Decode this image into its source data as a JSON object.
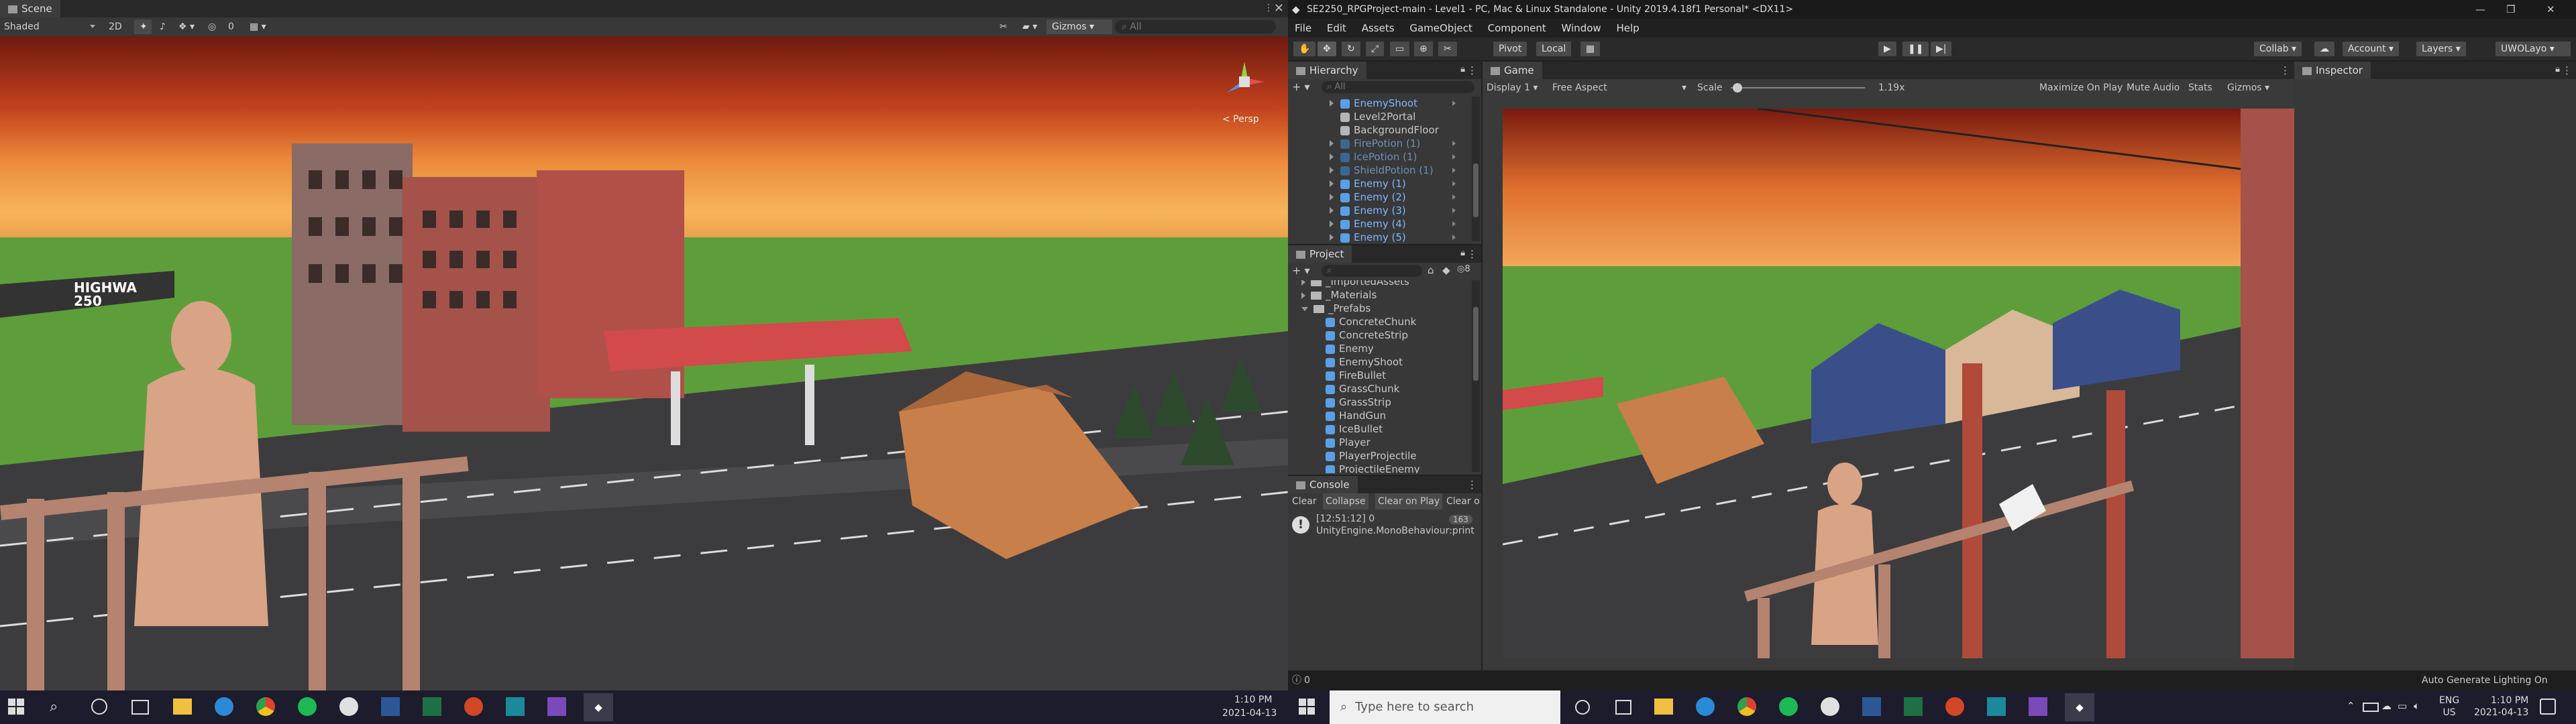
{
  "scene": {
    "tab_label": "Scene",
    "shading_mode": "Shaded",
    "mode_2d": "2D",
    "gizmo_count": "0",
    "gizmos_label": "Gizmos",
    "search_placeholder": "All",
    "persp_label": "< Persp",
    "billboard_line1": "HIGHWA",
    "billboard_line2": "250"
  },
  "editor": {
    "title": "SE2250_RPGProject-main - Level1 - PC, Mac & Linux Standalone - Unity 2019.4.18f1 Personal* <DX11>",
    "menu": [
      "File",
      "Edit",
      "Assets",
      "GameObject",
      "Component",
      "Window",
      "Help"
    ],
    "pivot_label": "Pivot",
    "local_label": "Local",
    "collab_label": "Collab",
    "account_label": "Account",
    "layers_label": "Layers",
    "layout_label": "UWOLayo"
  },
  "hierarchy": {
    "tab_label": "Hierarchy",
    "search_placeholder": "All",
    "items": [
      {
        "label": "EnemyShoot",
        "style": "blue",
        "icon": "cube",
        "arrow": true
      },
      {
        "label": "Level2Portal",
        "style": "normal",
        "icon": "cube-gray",
        "arrow": false
      },
      {
        "label": "BackgroundFloor",
        "style": "normal",
        "icon": "cube-gray",
        "arrow": false
      },
      {
        "label": "FirePotion (1)",
        "style": "faded",
        "icon": "cube-faded",
        "arrow": true
      },
      {
        "label": "IcePotion (1)",
        "style": "faded",
        "icon": "cube-faded",
        "arrow": true
      },
      {
        "label": "ShieldPotion (1)",
        "style": "faded",
        "icon": "cube-faded",
        "arrow": true
      },
      {
        "label": "Enemy (1)",
        "style": "blue",
        "icon": "cube",
        "arrow": true
      },
      {
        "label": "Enemy (2)",
        "style": "blue",
        "icon": "cube",
        "arrow": true
      },
      {
        "label": "Enemy (3)",
        "style": "blue",
        "icon": "cube",
        "arrow": true
      },
      {
        "label": "Enemy (4)",
        "style": "blue",
        "icon": "cube",
        "arrow": true
      },
      {
        "label": "Enemy (5)",
        "style": "blue",
        "icon": "cube",
        "arrow": true
      }
    ]
  },
  "project": {
    "tab_label": "Project",
    "count": "8",
    "folders": [
      "_ImportedAssets",
      "_Materials",
      "_Prefabs"
    ],
    "prefabs": [
      "ConcreteChunk",
      "ConcreteStrip",
      "Enemy",
      "EnemyShoot",
      "FireBullet",
      "GrassChunk",
      "GrassStrip",
      "HandGun",
      "IceBullet",
      "Player",
      "PlayerProjectile",
      "ProjectileEnemy"
    ]
  },
  "console": {
    "tab_label": "Console",
    "buttons": [
      "Clear",
      "Collapse",
      "Clear on Play",
      "Clear o"
    ],
    "entry_time": "[12:51:12] 0",
    "entry_source": "UnityEngine.MonoBehaviour:print",
    "entry_count": "163",
    "status_count": "0"
  },
  "game": {
    "tab_label": "Game",
    "display": "Display 1",
    "aspect": "Free Aspect",
    "scale_label": "Scale",
    "scale_value": "1.19x",
    "scale_fraction": 0.05,
    "maximize_label": "Maximize On Play",
    "mute_label": "Mute Audio",
    "stats_label": "Stats",
    "gizmos_label": "Gizmos"
  },
  "inspector": {
    "tab_label": "Inspector",
    "status": "Auto Generate Lighting On"
  },
  "taskbar": {
    "search_placeholder": "Type here to search",
    "left_time": "1:10 PM",
    "left_date": "2021-04-13",
    "right_time": "1:10 PM",
    "right_date": "2021-04-13",
    "lang": "ENG",
    "region": "US"
  },
  "colors": {
    "accent_blue": "#5aa0e6",
    "panel": "#383838",
    "taskbar": "#1c1c2c",
    "sky_top": "#7a1a10",
    "ground_green": "#5e9e3a"
  }
}
